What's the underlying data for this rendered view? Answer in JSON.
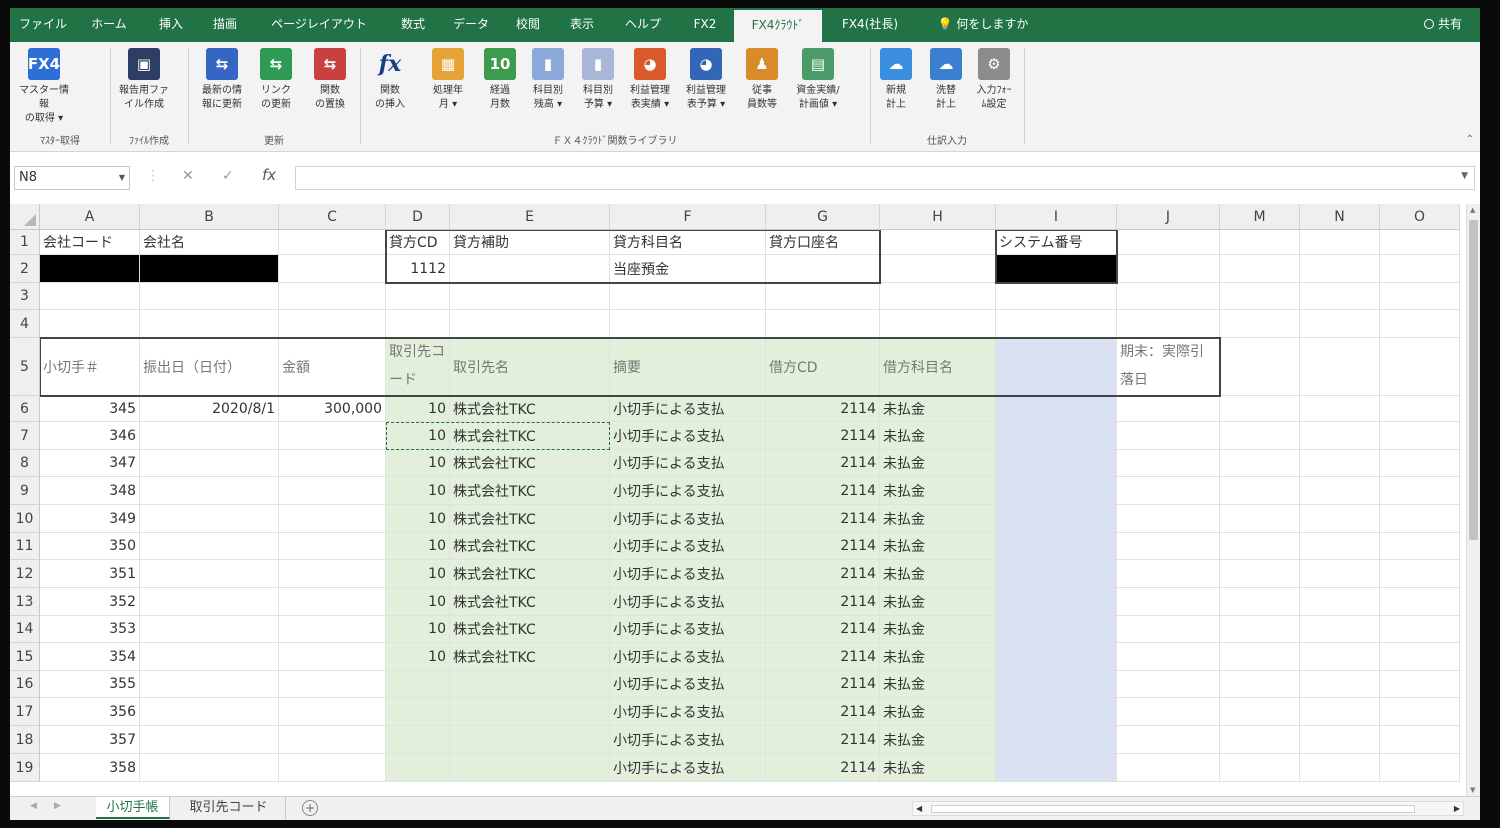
{
  "tabs": [
    "ファイル",
    "ホーム",
    "挿入",
    "描画",
    "ページレイアウト",
    "数式",
    "データ",
    "校閲",
    "表示",
    "ヘルプ",
    "FX2",
    "FX4ｸﾗｳﾄﾞ",
    "FX4(社長)"
  ],
  "tell_me": "何をしますか",
  "share": "共有",
  "ribbon": {
    "buttons": [
      {
        "label": "マスター情報\nの取得 ▾",
        "icon": "fx4-logo-icon",
        "glyph": "FX4",
        "color": "#2d6fd6"
      },
      {
        "label": "報告用ファ\nイル作成",
        "icon": "save-disk-icon",
        "glyph": "▣",
        "color": "#2c3e63"
      },
      {
        "label": "最新の情\n報に更新",
        "icon": "refresh-arrows-icon",
        "glyph": "⇆",
        "color": "#3566c4"
      },
      {
        "label": "リンク\nの更新",
        "icon": "link-update-icon",
        "glyph": "⇆",
        "color": "#2f9a55"
      },
      {
        "label": "関数\nの置換",
        "icon": "function-replace-icon",
        "glyph": "⇆",
        "color": "#c94040"
      },
      {
        "label": "関数\nの挿入",
        "icon": "insert-function-icon",
        "glyph": "fx",
        "color": "#ffffff"
      },
      {
        "label": "処理年\n月 ▾",
        "icon": "calendar-icon",
        "glyph": "▦",
        "color": "#e6a33a"
      },
      {
        "label": "経過\n月数",
        "icon": "calendar-10-icon",
        "glyph": "10",
        "color": "#3c9b4e"
      },
      {
        "label": "科目別\n残高 ▾",
        "icon": "bar-chart-icon",
        "glyph": "▮",
        "color": "#8ba9d9"
      },
      {
        "label": "科目別\n予算 ▾",
        "icon": "budget-chart-icon",
        "glyph": "▮",
        "color": "#a8b7d8"
      },
      {
        "label": "利益管理\n表実績 ▾",
        "icon": "pie-chart-icon",
        "glyph": "◕",
        "color": "#d95b2b"
      },
      {
        "label": "利益管理\n表予算 ▾",
        "icon": "pie-chart-budget-icon",
        "glyph": "◕",
        "color": "#3466b8"
      },
      {
        "label": "従事\n員数等",
        "icon": "staff-count-icon",
        "glyph": "♟",
        "color": "#d98b2b"
      },
      {
        "label": "資金実績/\n計画値 ▾",
        "icon": "funds-chart-icon",
        "glyph": "▤",
        "color": "#4a9a6a"
      },
      {
        "label": "新規\n計上",
        "icon": "cloud-new-icon",
        "glyph": "☁",
        "color": "#3a8ee0"
      },
      {
        "label": "洗替\n計上",
        "icon": "cloud-refresh-icon",
        "glyph": "☁",
        "color": "#3a7fd0"
      },
      {
        "label": "入力ﾌｫｰ\nﾑ設定",
        "icon": "gear-icon",
        "glyph": "⚙",
        "color": "#8c8c8c"
      }
    ],
    "groups": [
      "ﾏｽﾀｰ取得",
      "ﾌｧｲﾙ作成",
      "更新",
      "ＦＸ４ｸﾗｳﾄﾞ関数ライブラリ",
      "仕訳入力"
    ]
  },
  "formula_bar": {
    "name_box": "N8",
    "formula": ""
  },
  "columns": [
    "A",
    "B",
    "C",
    "D",
    "E",
    "F",
    "G",
    "H",
    "I",
    "J",
    "M",
    "N",
    "O"
  ],
  "rows": [
    "1",
    "2",
    "3",
    "4",
    "5",
    "6",
    "7",
    "8",
    "9",
    "10",
    "11",
    "12",
    "13",
    "14",
    "15",
    "16",
    "17",
    "18",
    "19"
  ],
  "header_block": {
    "company_code_label": "会社コード",
    "company_name_label": "会社名",
    "credit_cd_label": "貸方CD",
    "credit_sub_label": "貸方補助",
    "credit_account_label": "貸方科目名",
    "credit_bank_label": "貸方口座名",
    "system_no_label": "システム番号",
    "credit_cd_value": "1112",
    "credit_account_value": "当座預金"
  },
  "table_headers": {
    "check_no": "小切手＃",
    "issue_date": "振出日（日付）",
    "amount": "金額",
    "partner_code": "取引先コード",
    "partner_name": "取引先名",
    "summary": "摘要",
    "debit_cd": "借方CD",
    "debit_account": "借方科目名",
    "month_end": "期末：実際引落日"
  },
  "table_rows": [
    {
      "check": "345",
      "date": "2020/8/1",
      "amount": "300,000",
      "pcode": "10",
      "pname": "株式会社TKC",
      "summary": "小切手による支払",
      "dcd": "2114",
      "dname": "未払金"
    },
    {
      "check": "346",
      "date": "",
      "amount": "",
      "pcode": "10",
      "pname": "株式会社TKC",
      "summary": "小切手による支払",
      "dcd": "2114",
      "dname": "未払金"
    },
    {
      "check": "347",
      "date": "",
      "amount": "",
      "pcode": "10",
      "pname": "株式会社TKC",
      "summary": "小切手による支払",
      "dcd": "2114",
      "dname": "未払金"
    },
    {
      "check": "348",
      "date": "",
      "amount": "",
      "pcode": "10",
      "pname": "株式会社TKC",
      "summary": "小切手による支払",
      "dcd": "2114",
      "dname": "未払金"
    },
    {
      "check": "349",
      "date": "",
      "amount": "",
      "pcode": "10",
      "pname": "株式会社TKC",
      "summary": "小切手による支払",
      "dcd": "2114",
      "dname": "未払金"
    },
    {
      "check": "350",
      "date": "",
      "amount": "",
      "pcode": "10",
      "pname": "株式会社TKC",
      "summary": "小切手による支払",
      "dcd": "2114",
      "dname": "未払金"
    },
    {
      "check": "351",
      "date": "",
      "amount": "",
      "pcode": "10",
      "pname": "株式会社TKC",
      "summary": "小切手による支払",
      "dcd": "2114",
      "dname": "未払金"
    },
    {
      "check": "352",
      "date": "",
      "amount": "",
      "pcode": "10",
      "pname": "株式会社TKC",
      "summary": "小切手による支払",
      "dcd": "2114",
      "dname": "未払金"
    },
    {
      "check": "353",
      "date": "",
      "amount": "",
      "pcode": "10",
      "pname": "株式会社TKC",
      "summary": "小切手による支払",
      "dcd": "2114",
      "dname": "未払金"
    },
    {
      "check": "354",
      "date": "",
      "amount": "",
      "pcode": "10",
      "pname": "株式会社TKC",
      "summary": "小切手による支払",
      "dcd": "2114",
      "dname": "未払金"
    },
    {
      "check": "355",
      "date": "",
      "amount": "",
      "pcode": "",
      "pname": "",
      "summary": "小切手による支払",
      "dcd": "2114",
      "dname": "未払金"
    },
    {
      "check": "356",
      "date": "",
      "amount": "",
      "pcode": "",
      "pname": "",
      "summary": "小切手による支払",
      "dcd": "2114",
      "dname": "未払金"
    },
    {
      "check": "357",
      "date": "",
      "amount": "",
      "pcode": "",
      "pname": "",
      "summary": "小切手による支払",
      "dcd": "2114",
      "dname": "未払金"
    },
    {
      "check": "358",
      "date": "",
      "amount": "",
      "pcode": "",
      "pname": "",
      "summary": "小切手による支払",
      "dcd": "2114",
      "dname": "未払金"
    }
  ],
  "sheets": [
    "小切手帳",
    "取引先コード"
  ],
  "colors": {
    "accent": "#217346",
    "input_fill": "#e2efda",
    "system_fill": "#d9e1f2"
  }
}
